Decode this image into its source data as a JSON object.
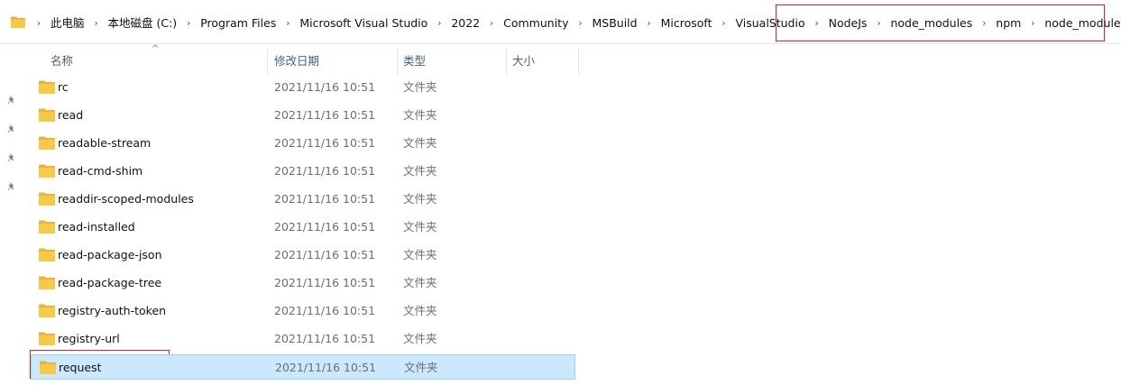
{
  "address_bar": {
    "crumbs": [
      "此电脑",
      "本地磁盘 (C:)",
      "Program Files",
      "Microsoft Visual Studio",
      "2022",
      "Community",
      "MSBuild",
      "Microsoft",
      "VisualStudio",
      "NodeJs",
      "node_modules",
      "npm",
      "node_modules"
    ],
    "separator": "›"
  },
  "columns": {
    "name": "名称",
    "modified": "修改日期",
    "type": "类型",
    "size": "大小"
  },
  "files": [
    {
      "name": "rc",
      "modified": "2021/11/16 10:51",
      "type": "文件夹"
    },
    {
      "name": "read",
      "modified": "2021/11/16 10:51",
      "type": "文件夹"
    },
    {
      "name": "readable-stream",
      "modified": "2021/11/16 10:51",
      "type": "文件夹"
    },
    {
      "name": "read-cmd-shim",
      "modified": "2021/11/16 10:51",
      "type": "文件夹"
    },
    {
      "name": "readdir-scoped-modules",
      "modified": "2021/11/16 10:51",
      "type": "文件夹"
    },
    {
      "name": "read-installed",
      "modified": "2021/11/16 10:51",
      "type": "文件夹"
    },
    {
      "name": "read-package-json",
      "modified": "2021/11/16 10:51",
      "type": "文件夹"
    },
    {
      "name": "read-package-tree",
      "modified": "2021/11/16 10:51",
      "type": "文件夹"
    },
    {
      "name": "registry-auth-token",
      "modified": "2021/11/16 10:51",
      "type": "文件夹"
    },
    {
      "name": "registry-url",
      "modified": "2021/11/16 10:51",
      "type": "文件夹"
    },
    {
      "name": "request",
      "modified": "2021/11/16 10:51",
      "type": "文件夹",
      "selected": true
    }
  ],
  "colors": {
    "selection_bg": "#cce8ff",
    "selection_border": "#99d1ff",
    "annotation_red": "#d9232a",
    "folder_yellow": "#f8c945"
  },
  "icons": [
    "folder-icon",
    "pin-icon",
    "chevron-right-icon",
    "sort-up-icon"
  ]
}
